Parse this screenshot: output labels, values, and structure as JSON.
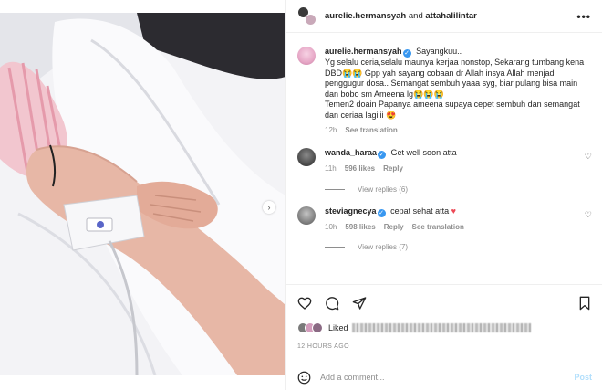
{
  "header": {
    "user1": "aurelie.hermansyah",
    "and": "and",
    "user2": "attahalilintar",
    "more": "•••"
  },
  "caption": {
    "username": "aurelie.hermansyah",
    "lines": [
      "Sayangkuu..",
      "Yg selalu ceria,selalu maunya kerjaa nonstop, Sekarang tumbang kena DBD😭😭 Gpp yah sayang cobaan dr Allah insya Allah menjadi penggugur dosa.. Semangat sembuh yaaa syg, biar pulang bisa main dan bobo sm Ameena lg😭😭😭",
      "Temen2 doain Papanya ameena supaya cepet sembuh dan semangat dan ceriaa lagiiii 😍"
    ],
    "time": "12h",
    "see_translation": "See translation"
  },
  "comments": [
    {
      "username": "wanda_haraa",
      "text": "Get well soon atta",
      "time": "11h",
      "likes": "596 likes",
      "reply": "Reply",
      "view_replies": "View replies (6)"
    },
    {
      "username": "steviagnecya",
      "text": "cepat sehat atta",
      "heart": "♥",
      "time": "10h",
      "likes": "598 likes",
      "reply": "Reply",
      "see_translation": "See translation",
      "view_replies": "View replies (7)"
    }
  ],
  "likes_line": {
    "label": "Liked"
  },
  "post_time": "12 HOURS AGO",
  "add_comment": {
    "placeholder": "Add a comment...",
    "post": "Post"
  },
  "colors": {
    "verified": "#3897f0",
    "post_disabled": "#b2dffc",
    "heart_red": "#ed4956"
  },
  "icons": [
    "heart-icon",
    "comment-icon",
    "share-icon",
    "bookmark-icon",
    "emoji-icon",
    "chevron-right-icon",
    "verified-icon"
  ]
}
